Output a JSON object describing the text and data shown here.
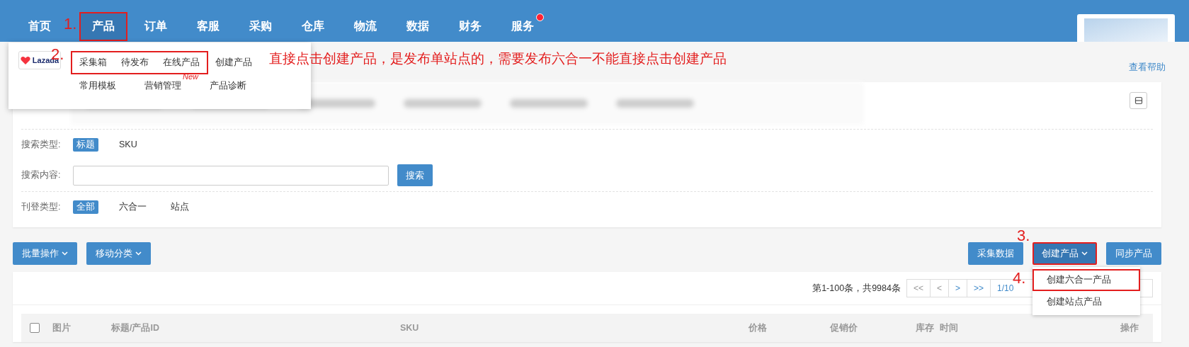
{
  "nav": {
    "items": [
      {
        "label": "首页",
        "selected": false,
        "outlined": false,
        "dot": false
      },
      {
        "label": "产品",
        "selected": true,
        "outlined": true,
        "marker": "1.",
        "dot": false
      },
      {
        "label": "订单",
        "selected": false,
        "outlined": false,
        "dot": false
      },
      {
        "label": "客服",
        "selected": false,
        "outlined": false,
        "dot": false
      },
      {
        "label": "采购",
        "selected": false,
        "outlined": false,
        "dot": false
      },
      {
        "label": "仓库",
        "selected": false,
        "outlined": false,
        "dot": false
      },
      {
        "label": "物流",
        "selected": false,
        "outlined": false,
        "dot": false
      },
      {
        "label": "数据",
        "selected": false,
        "outlined": false,
        "dot": false
      },
      {
        "label": "财务",
        "selected": false,
        "outlined": false,
        "dot": false
      },
      {
        "label": "服务",
        "selected": false,
        "outlined": false,
        "dot": true
      }
    ]
  },
  "product_menu": {
    "logo": "Lazada",
    "rows": [
      {
        "marker": "2.",
        "outlined": [
          "采集箱",
          "待发布",
          "在线产品"
        ],
        "items": [
          {
            "label": "创建产品"
          }
        ]
      },
      {
        "outlined": [],
        "items": [
          {
            "label": "常用模板"
          },
          {
            "label": "营销管理",
            "tag": "New"
          },
          {
            "label": "产品诊断"
          }
        ]
      }
    ]
  },
  "note": "直接点击创建产品，是发布单站点的，需要发布六合一不能直接点击创建产品",
  "help_link": "查看帮助",
  "filters": {
    "search_type": {
      "label": "搜索类型:",
      "options": [
        {
          "label": "标题",
          "selected": true
        },
        {
          "label": "SKU",
          "selected": false
        }
      ]
    },
    "search_content": {
      "label": "搜索内容:",
      "button": "搜索"
    },
    "listing_type": {
      "label": "刊登类型:",
      "options": [
        {
          "label": "全部",
          "selected": true
        },
        {
          "label": "六合一",
          "selected": false
        },
        {
          "label": "站点",
          "selected": false
        }
      ]
    }
  },
  "toolbar": {
    "left": [
      "批量操作",
      "移动分类"
    ],
    "right": [
      {
        "label": "采集数据",
        "dropdown": false,
        "outlined": false
      },
      {
        "label": "创建产品",
        "dropdown": true,
        "outlined": true,
        "marker": "3."
      },
      {
        "label": "同步产品",
        "dropdown": false,
        "outlined": false
      }
    ]
  },
  "create_menu": [
    {
      "label": "创建六合一产品",
      "outlined": true,
      "marker": "4."
    },
    {
      "label": "创建站点产品",
      "outlined": false
    }
  ],
  "pagination": {
    "summary": "第1-100条，共9984条",
    "buttons": [
      {
        "label": "<<",
        "disabled": true
      },
      {
        "label": "<",
        "disabled": true
      },
      {
        "label": ">",
        "disabled": false
      },
      {
        "label": ">>",
        "disabled": false
      }
    ],
    "page": "1/10"
  },
  "table": {
    "select_all_checked": false,
    "columns": [
      "图片",
      "标题/产品ID",
      "SKU",
      "价格",
      "促销价",
      "库存",
      "时间",
      "操作"
    ]
  }
}
